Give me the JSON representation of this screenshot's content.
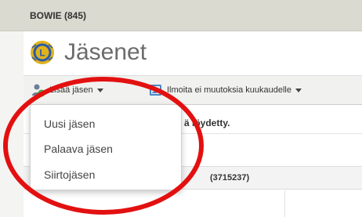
{
  "header": {
    "club_title": "BOWIE (845)"
  },
  "page": {
    "title": "Jäsenet",
    "logo_icon": "lions-logo-icon"
  },
  "toolbar": {
    "add_member_label": "Lisää jäsen",
    "add_member_icon": "add-user-icon",
    "notify_label": "Ilmoita ei muutoksia kuukaudelle",
    "notify_icon": "contact-card-icon"
  },
  "add_member_menu": {
    "items": [
      {
        "label": "Uusi jäsen"
      },
      {
        "label": "Palaava jäsen"
      },
      {
        "label": "Siirtojäsen"
      }
    ]
  },
  "content": {
    "result_fragment": "ä löydetty.",
    "member_id_fragment": "(3715237)"
  },
  "annotation": {
    "ring_color": "#e31010"
  },
  "colors": {
    "header_bg": "#dadad0",
    "toolbar_bg": "#f1f1ef",
    "logo_blue": "#2a5aa8",
    "logo_gold": "#e0b21c"
  }
}
